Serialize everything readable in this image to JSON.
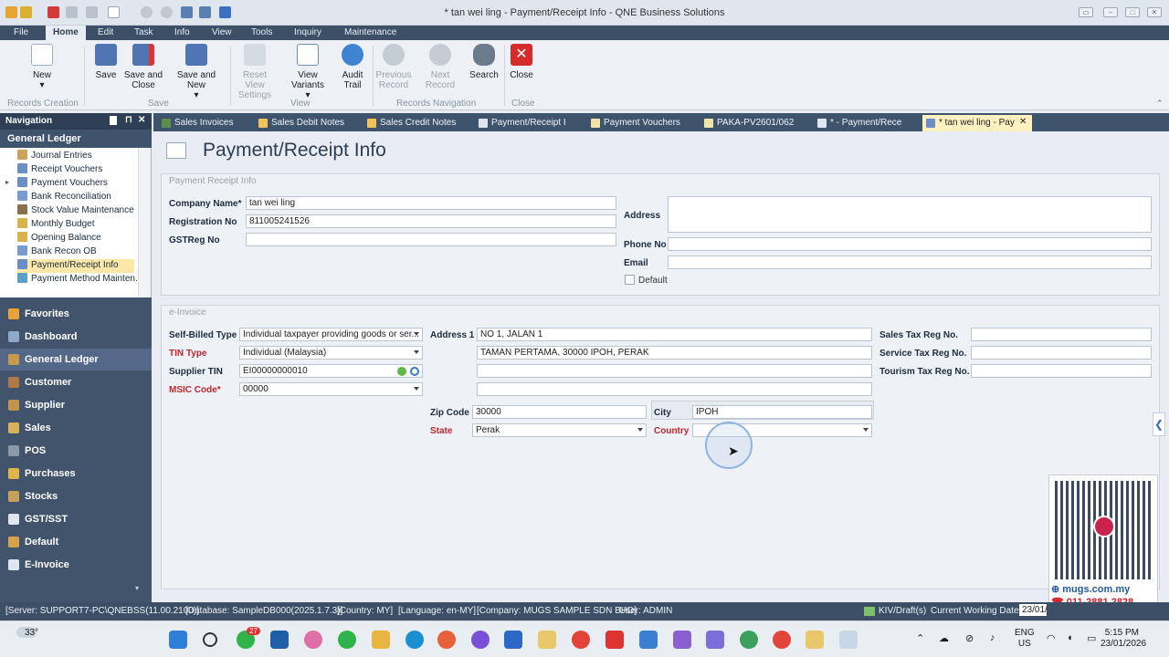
{
  "window": {
    "title": "* tan wei ling - Payment/Receipt Info - QNE Business Solutions"
  },
  "menu": [
    "File",
    "Home",
    "Edit",
    "Task",
    "Info",
    "View",
    "Tools",
    "Inquiry",
    "Maintenance"
  ],
  "ribbon": {
    "new": "New",
    "save": "Save",
    "save_close": "Save and Close",
    "save_new": "Save and New",
    "reset_view": "Reset View Settings",
    "view_variants": "View Variants",
    "audit": "Audit Trail",
    "prev": "Previous Record",
    "next": "Next Record",
    "search": "Search",
    "close": "Close",
    "groups": {
      "records_creation": "Records Creation",
      "save": "Save",
      "view": "View",
      "records_navigation": "Records Navigation",
      "close": "Close"
    }
  },
  "nav": {
    "header": "Navigation",
    "section": "General Ledger",
    "tree": [
      "Journal Entries",
      "Receipt Vouchers",
      "Payment Vouchers",
      "Bank Reconciliation",
      "Stock Value Maintenance",
      "Monthly Budget",
      "Opening Balance",
      "Bank Recon OB",
      "Payment/Receipt Info",
      "Payment Method Mainten..."
    ],
    "modules": [
      "Favorites",
      "Dashboard",
      "General Ledger",
      "Customer",
      "Supplier",
      "Sales",
      "POS",
      "Purchases",
      "Stocks",
      "GST/SST",
      "Default",
      "E-Invoice"
    ]
  },
  "tabs": [
    "Sales Invoices",
    "Sales Debit Notes",
    "Sales Credit Notes",
    "Payment/Receipt I",
    "Payment Vouchers",
    "PAKA-PV2601/062",
    "* - Payment/Rece",
    "* tan wei ling - Pay"
  ],
  "page": {
    "title": "Payment/Receipt Info"
  },
  "info": {
    "legend": "Payment Receipt Info",
    "company_label": "Company Name*",
    "company": "tan wei ling",
    "reg_label": "Registration No",
    "reg": "811005241526",
    "gst_label": "GSTReg No",
    "gst": "",
    "address_label": "Address",
    "address": "",
    "phone_label": "Phone No",
    "phone": "",
    "email_label": "Email",
    "email": "",
    "default_label": "Default"
  },
  "einvoice": {
    "legend": "e-Invoice",
    "self_billed_label": "Self-Billed Type",
    "self_billed": "Individual taxpayer providing goods or ser...",
    "tin_type_label": "TIN Type",
    "tin_type": "Individual (Malaysia)",
    "supplier_tin_label": "Supplier TIN",
    "supplier_tin": "EI00000000010",
    "msic_label": "MSIC Code*",
    "msic": "00000",
    "address1_label": "Address 1",
    "address1": "NO 1, JALAN 1",
    "address2": "TAMAN PERTAMA, 30000 IPOH, PERAK",
    "address3": "",
    "address4": "",
    "zip_label": "Zip Code",
    "zip": "30000",
    "city_label": "City",
    "city": "IPOH",
    "state_label": "State",
    "state": "Perak",
    "country_label": "Country",
    "country": "",
    "sales_tax_label": "Sales Tax Reg No.",
    "service_tax_label": "Service Tax Reg No.",
    "tourism_tax_label": "Tourism Tax Reg No."
  },
  "status": {
    "server": "[Server: SUPPORT7-PC\\QNEBSS(11.00.2100)]",
    "database": "[Database: SampleDB000(2025.1.7.3)]",
    "country": "[Country: MY]",
    "language": "[Language: en-MY]",
    "company": "[Company: MUGS SAMPLE SDN BHD]",
    "user": "User: ADMIN",
    "kiv": "KIV/Draft(s)",
    "cwd_label": "Current Working Date:",
    "cwd": "23/01/2026"
  },
  "taskbar": {
    "temp": "33°",
    "lang1": "ENG",
    "lang2": "US",
    "time": "5:15 PM",
    "date": "23/01/2026",
    "badge": "27"
  },
  "promo": {
    "url": "mugs.com.my",
    "phone": "011-2881 2828"
  }
}
